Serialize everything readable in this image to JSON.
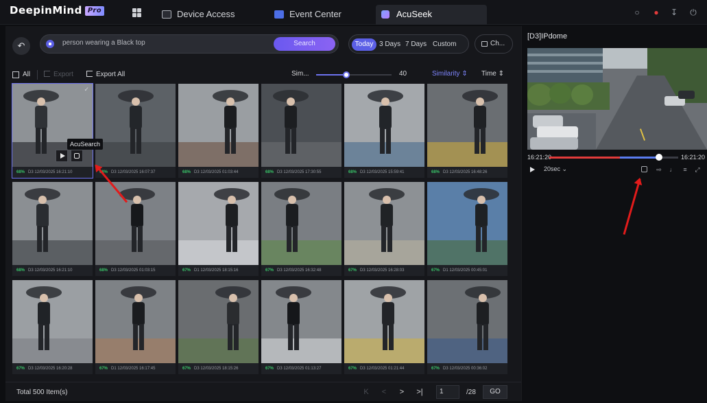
{
  "app": {
    "logo": "DeepinMind",
    "logo_badge": "Pro",
    "tabs": [
      {
        "label": "Device Access",
        "icon": "monitor-icon"
      },
      {
        "label": "Event Center",
        "icon": "event-icon"
      },
      {
        "label": "AcuSeek",
        "icon": "acuseek-icon",
        "active": true
      }
    ]
  },
  "search": {
    "query": "person wearing a Black top",
    "button": "Search",
    "date_options": [
      "Today",
      "3 Days",
      "7 Days",
      "Custom"
    ],
    "selected_date": "Today",
    "channel_button": "Ch..."
  },
  "toolbar": {
    "all_label": "All",
    "export_label": "Export",
    "export_all_label": "Export All",
    "similarity_label": "Sim...",
    "similarity_value": "40",
    "similarity_fraction": 0.4,
    "sort_similarity": "Similarity",
    "sort_time": "Time"
  },
  "tooltip": "AcuSearch",
  "results": [
    {
      "pct": "68%",
      "ch": "D3",
      "ts": "12/03/2025 16:21:10",
      "selected": true
    },
    {
      "pct": "68%",
      "ch": "D3",
      "ts": "12/03/2025 16:07:37"
    },
    {
      "pct": "68%",
      "ch": "D3",
      "ts": "12/03/2025 01:03:44"
    },
    {
      "pct": "68%",
      "ch": "D3",
      "ts": "12/03/2025 17:30:55"
    },
    {
      "pct": "68%",
      "ch": "D3",
      "ts": "12/03/2025 15:59:41"
    },
    {
      "pct": "68%",
      "ch": "D3",
      "ts": "12/03/2025 16:48:26"
    },
    {
      "pct": "68%",
      "ch": "D3",
      "ts": "12/03/2025 16:21:10"
    },
    {
      "pct": "68%",
      "ch": "D3",
      "ts": "12/03/2025 01:03:15"
    },
    {
      "pct": "67%",
      "ch": "D1",
      "ts": "12/03/2025 18:15:16"
    },
    {
      "pct": "67%",
      "ch": "D3",
      "ts": "12/03/2025 16:32:48"
    },
    {
      "pct": "67%",
      "ch": "D3",
      "ts": "12/03/2025 16:28:03"
    },
    {
      "pct": "67%",
      "ch": "D1",
      "ts": "12/03/2025 00:45:01"
    },
    {
      "pct": "67%",
      "ch": "D3",
      "ts": "12/03/2025 16:20:28"
    },
    {
      "pct": "67%",
      "ch": "D1",
      "ts": "12/03/2025 16:17:45"
    },
    {
      "pct": "67%",
      "ch": "D3",
      "ts": "12/03/2025 18:15:26"
    },
    {
      "pct": "67%",
      "ch": "D3",
      "ts": "12/03/2025 01:13:27"
    },
    {
      "pct": "67%",
      "ch": "D3",
      "ts": "12/03/2025 01:21:44"
    },
    {
      "pct": "67%",
      "ch": "D3",
      "ts": "12/03/2025 00:36:02"
    }
  ],
  "pagination": {
    "total": "Total 500 Item(s)",
    "current_page": "1",
    "total_pages": "/28",
    "go": "GO"
  },
  "player": {
    "title": "[D3]IPdome",
    "start_time": "16:21:20",
    "end_time": "16:21:20",
    "speed": "20sec",
    "red_fraction": 0.55,
    "blue_fraction": 0.3
  },
  "colors": {
    "accent": "#6d73f0",
    "match_green": "#39c469",
    "annotation_red": "#e21b1b"
  }
}
